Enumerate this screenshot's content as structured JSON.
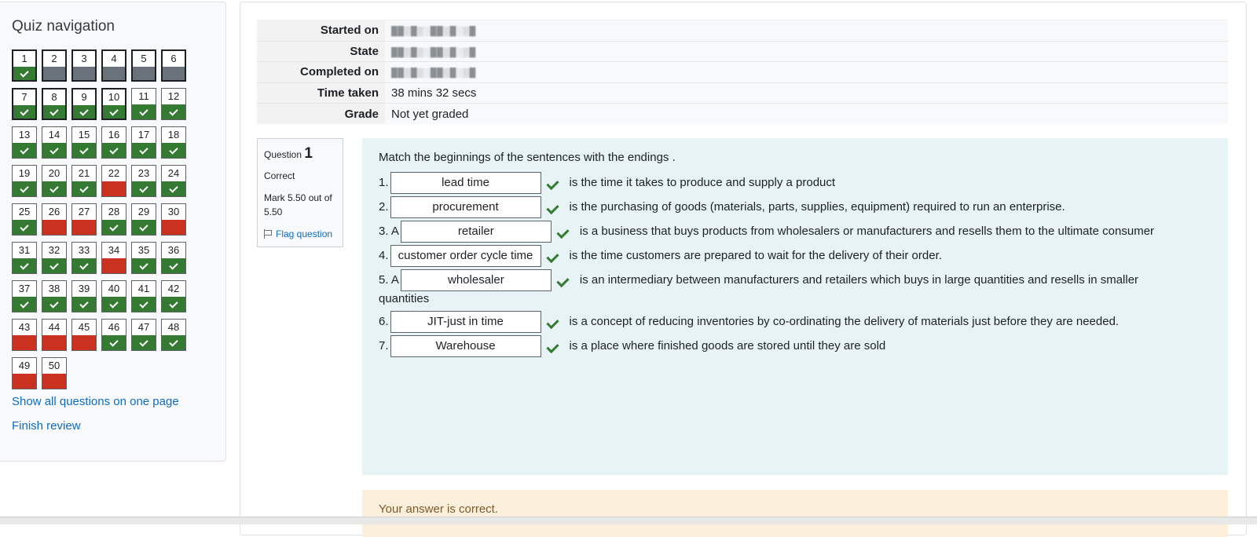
{
  "nav": {
    "title": "Quiz navigation",
    "questions": [
      {
        "n": "1",
        "state": "correct",
        "current": true
      },
      {
        "n": "2",
        "state": "grey",
        "current": true
      },
      {
        "n": "3",
        "state": "grey",
        "current": true
      },
      {
        "n": "4",
        "state": "grey",
        "current": true
      },
      {
        "n": "5",
        "state": "grey",
        "current": true
      },
      {
        "n": "6",
        "state": "grey",
        "current": true
      },
      {
        "n": "7",
        "state": "correct",
        "current": true
      },
      {
        "n": "8",
        "state": "correct",
        "current": true
      },
      {
        "n": "9",
        "state": "correct",
        "current": true
      },
      {
        "n": "10",
        "state": "correct",
        "current": true
      },
      {
        "n": "11",
        "state": "correct",
        "current": false
      },
      {
        "n": "12",
        "state": "correct",
        "current": false
      },
      {
        "n": "13",
        "state": "correct",
        "current": false
      },
      {
        "n": "14",
        "state": "correct",
        "current": false
      },
      {
        "n": "15",
        "state": "correct",
        "current": false
      },
      {
        "n": "16",
        "state": "correct",
        "current": false
      },
      {
        "n": "17",
        "state": "correct",
        "current": false
      },
      {
        "n": "18",
        "state": "correct",
        "current": false
      },
      {
        "n": "19",
        "state": "correct",
        "current": false
      },
      {
        "n": "20",
        "state": "correct",
        "current": false
      },
      {
        "n": "21",
        "state": "correct",
        "current": false
      },
      {
        "n": "22",
        "state": "incorrect",
        "current": false
      },
      {
        "n": "23",
        "state": "correct",
        "current": false
      },
      {
        "n": "24",
        "state": "correct",
        "current": false
      },
      {
        "n": "25",
        "state": "correct",
        "current": false
      },
      {
        "n": "26",
        "state": "incorrect",
        "current": false
      },
      {
        "n": "27",
        "state": "incorrect",
        "current": false
      },
      {
        "n": "28",
        "state": "correct",
        "current": false
      },
      {
        "n": "29",
        "state": "correct",
        "current": false
      },
      {
        "n": "30",
        "state": "incorrect",
        "current": false
      },
      {
        "n": "31",
        "state": "correct",
        "current": false
      },
      {
        "n": "32",
        "state": "correct",
        "current": false
      },
      {
        "n": "33",
        "state": "correct",
        "current": false
      },
      {
        "n": "34",
        "state": "incorrect",
        "current": false
      },
      {
        "n": "35",
        "state": "correct",
        "current": false
      },
      {
        "n": "36",
        "state": "correct",
        "current": false
      },
      {
        "n": "37",
        "state": "correct",
        "current": false
      },
      {
        "n": "38",
        "state": "correct",
        "current": false
      },
      {
        "n": "39",
        "state": "correct",
        "current": false
      },
      {
        "n": "40",
        "state": "correct",
        "current": false
      },
      {
        "n": "41",
        "state": "correct",
        "current": false
      },
      {
        "n": "42",
        "state": "correct",
        "current": false
      },
      {
        "n": "43",
        "state": "incorrect",
        "current": false
      },
      {
        "n": "44",
        "state": "incorrect",
        "current": false
      },
      {
        "n": "45",
        "state": "incorrect",
        "current": false
      },
      {
        "n": "46",
        "state": "correct",
        "current": false
      },
      {
        "n": "47",
        "state": "correct",
        "current": false
      },
      {
        "n": "48",
        "state": "correct",
        "current": false
      },
      {
        "n": "49",
        "state": "incorrect",
        "current": false
      },
      {
        "n": "50",
        "state": "incorrect",
        "current": false
      }
    ],
    "show_all": "Show all questions on one page",
    "finish_review": "Finish review"
  },
  "summary": {
    "rows": [
      {
        "label": "Started on",
        "value": "",
        "redacted": true
      },
      {
        "label": "State",
        "value": "",
        "redacted": true
      },
      {
        "label": "Completed on",
        "value": "",
        "redacted": true
      },
      {
        "label": "Time taken",
        "value": "38 mins 32 secs",
        "redacted": false
      },
      {
        "label": "Grade",
        "value": "Not yet graded",
        "redacted": false
      }
    ]
  },
  "question": {
    "label": "Question",
    "number": "1",
    "state": "Correct",
    "grade": "Mark 5.50 out of 5.50",
    "flag": "Flag question",
    "text": "Match the beginnings of the sentences  with the endings .",
    "items": [
      {
        "prefix": "1.",
        "answer": "lead time",
        "suffix": "is the time it takes to produce and supply a product"
      },
      {
        "prefix": "2.",
        "answer": "procurement",
        "suffix": "is the purchasing of goods (materials, parts, supplies, equipment) required to run an enterprise."
      },
      {
        "prefix": "3. A",
        "answer": "retailer",
        "suffix": "is a business that buys products from wholesalers or manufacturers and resells them to the ultimate consumer"
      },
      {
        "prefix": "4.",
        "answer": "customer order cycle time",
        "suffix": "is the time customers are prepared to wait for the delivery of their order."
      },
      {
        "prefix": "5. A",
        "answer": "wholesaler",
        "suffix": "is an intermediary between manufacturers and retailers which buys in large quantities and resells in smaller",
        "wrap": "quantities"
      },
      {
        "prefix": "6.",
        "answer": "JIT-just in time",
        "suffix": "is a concept of reducing inventories by co-ordinating the delivery of materials just before they are needed."
      },
      {
        "prefix": "7.",
        "answer": "Warehouse",
        "suffix": "is a place where finished goods are stored until they are sold"
      }
    ],
    "feedback": "Your answer is correct."
  },
  "colors": {
    "correct": "#357a32",
    "incorrect": "#ca3120",
    "grey": "#6a737b",
    "link": "#0f6cbf"
  }
}
